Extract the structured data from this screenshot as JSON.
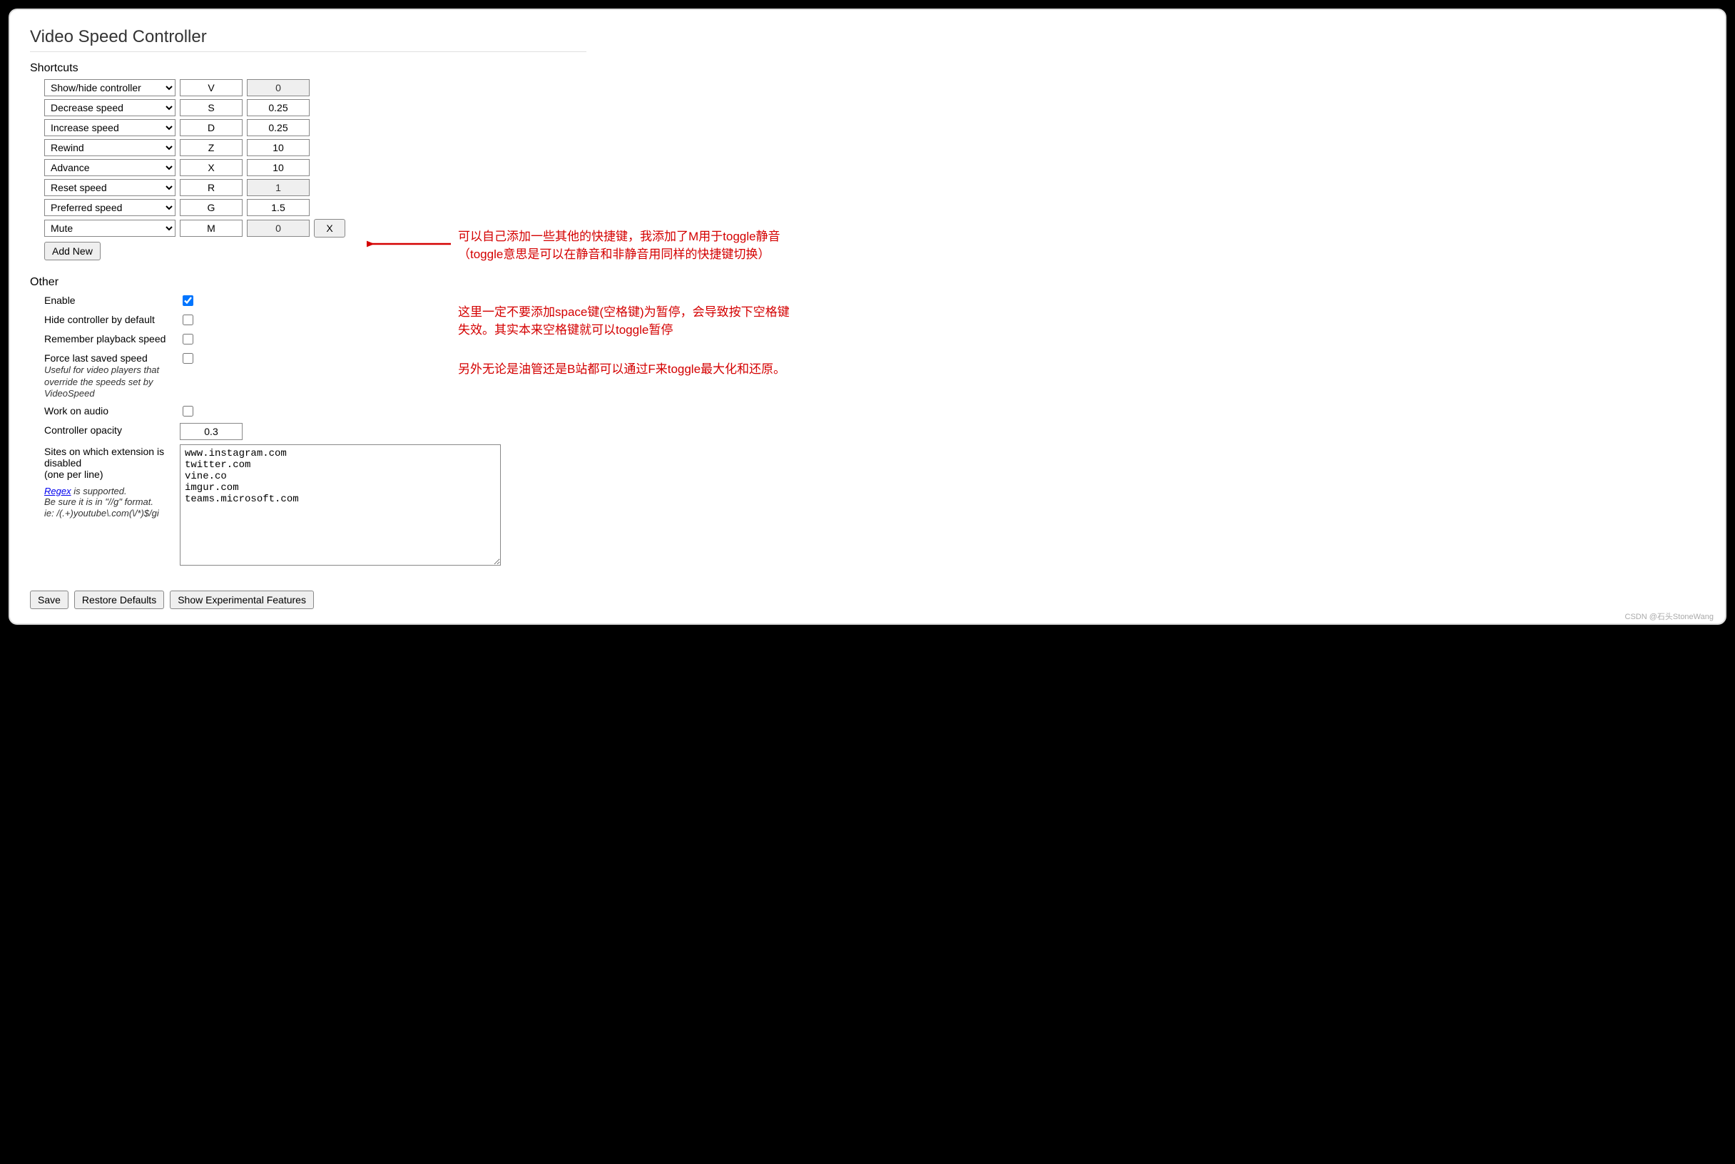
{
  "title": "Video Speed Controller",
  "sections": {
    "shortcuts_header": "Shortcuts",
    "other_header": "Other"
  },
  "shortcuts": [
    {
      "action": "Show/hide controller",
      "key": "V",
      "value": "0",
      "value_disabled": true,
      "removable": false
    },
    {
      "action": "Decrease speed",
      "key": "S",
      "value": "0.25",
      "value_disabled": false,
      "removable": false
    },
    {
      "action": "Increase speed",
      "key": "D",
      "value": "0.25",
      "value_disabled": false,
      "removable": false
    },
    {
      "action": "Rewind",
      "key": "Z",
      "value": "10",
      "value_disabled": false,
      "removable": false
    },
    {
      "action": "Advance",
      "key": "X",
      "value": "10",
      "value_disabled": false,
      "removable": false
    },
    {
      "action": "Reset speed",
      "key": "R",
      "value": "1",
      "value_disabled": true,
      "removable": false
    },
    {
      "action": "Preferred speed",
      "key": "G",
      "value": "1.5",
      "value_disabled": false,
      "removable": false
    },
    {
      "action": "Mute",
      "key": "M",
      "value": "0",
      "value_disabled": true,
      "removable": true
    }
  ],
  "buttons": {
    "add_new": "Add New",
    "remove_x": "X",
    "save": "Save",
    "restore": "Restore Defaults",
    "experimental": "Show Experimental Features"
  },
  "other": {
    "enable": {
      "label": "Enable",
      "checked": true
    },
    "hide_default": {
      "label": "Hide controller by default",
      "checked": false
    },
    "remember_speed": {
      "label": "Remember playback speed",
      "checked": false
    },
    "force_last": {
      "label": "Force last saved speed",
      "sub": "Useful for video players that override the speeds set by VideoSpeed",
      "checked": false
    },
    "work_audio": {
      "label": "Work on audio",
      "checked": false
    },
    "opacity": {
      "label": "Controller opacity",
      "value": "0.3"
    },
    "sites": {
      "label": "Sites on which extension is disabled",
      "sub": "(one per line)",
      "value": "www.instagram.com\ntwitter.com\nvine.co\nimgur.com\nteams.microsoft.com"
    },
    "regex_note": {
      "link": "Regex",
      "text1": " is supported.",
      "text2": "Be sure it is in \"//g\" format.",
      "text3": "ie: /(.+)youtube\\.com(\\/*)$/gi"
    }
  },
  "annotations": {
    "a1_line1": "可以自己添加一些其他的快捷键，我添加了M用于toggle静音",
    "a1_line2": "（toggle意思是可以在静音和非静音用同样的快捷键切换）",
    "a2_line1": "这里一定不要添加space键(空格键)为暂停，会导致按下空格键",
    "a2_line2": "失效。其实本来空格键就可以toggle暂停",
    "a3": "另外无论是油管还是B站都可以通过F来toggle最大化和还原。"
  },
  "watermark": "CSDN @石头StoneWang"
}
